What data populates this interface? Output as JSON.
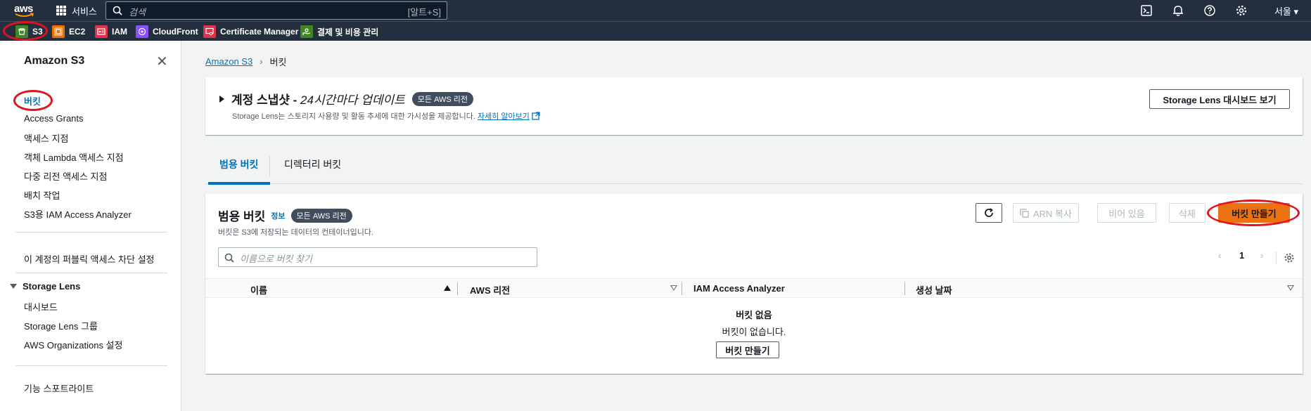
{
  "topbar": {
    "logo": "aws",
    "services_label": "서비스",
    "search_placeholder": "검색",
    "search_shortcut": "[알트+S]",
    "region": "서울 ▾",
    "icons": [
      "cloudshell-icon",
      "bell-icon",
      "help-icon",
      "settings-icon"
    ]
  },
  "favorites": [
    {
      "label": "S3",
      "color": "#3f8624"
    },
    {
      "label": "EC2",
      "color": "#ed7100"
    },
    {
      "label": "IAM",
      "color": "#dd344c"
    },
    {
      "label": "CloudFront",
      "color": "#8c4fff"
    },
    {
      "label": "Certificate Manager",
      "color": "#dd344c"
    },
    {
      "label": "결제 및 비용 관리",
      "color": "#3f8624"
    }
  ],
  "sidenav": {
    "title": "Amazon S3",
    "items": [
      "버킷",
      "Access Grants",
      "액세스 지점",
      "객체 Lambda 액세스 지점",
      "다중 리전 액세스 지점",
      "배치 작업",
      "S3용 IAM Access Analyzer"
    ],
    "block_public": "이 계정의 퍼블릭 액세스 차단 설정",
    "storage_lens": {
      "title": "Storage Lens",
      "items": [
        "대시보드",
        "Storage Lens 그룹",
        "AWS Organizations 설정"
      ]
    },
    "spotlight": "기능 스포트라이트"
  },
  "breadcrumb": {
    "root": "Amazon S3",
    "current": "버킷"
  },
  "snapshot": {
    "title_bold": "계정 스냅샷 - ",
    "title_italic": "24시간마다 업데이트",
    "badge": "모든 AWS 리전",
    "desc_prefix": "Storage Lens는 스토리지 사용량 및 활동 추세에 대한 가시성을 제공합니다.",
    "learn_more": "자세히 알아보기",
    "dashboard_button": "Storage Lens 대시보드 보기"
  },
  "tabs": [
    "범용 버킷",
    "디렉터리 버킷"
  ],
  "buckets": {
    "title": "범용 버킷",
    "info": "정보",
    "badge": "모든 AWS 리전",
    "description": "버킷은 S3에 저장되는 데이터의 컨테이너입니다.",
    "search_placeholder": "이름으로 버킷 찾기",
    "buttons": {
      "copy_arn": "ARN 복사",
      "empty": "비어 있음",
      "delete": "삭제",
      "create": "버킷 만들기"
    },
    "page": "1",
    "columns": [
      "이름",
      "AWS 리전",
      "IAM Access Analyzer",
      "생성 날짜"
    ],
    "empty_title": "버킷 없음",
    "empty_desc": "버킷이 없습니다.",
    "empty_create": "버킷 만들기"
  },
  "colors": {
    "accent": "#0073bb",
    "primary_button": "#ec7211",
    "nav_bg": "#232f3e",
    "highlight_ring": "#e0141e"
  }
}
